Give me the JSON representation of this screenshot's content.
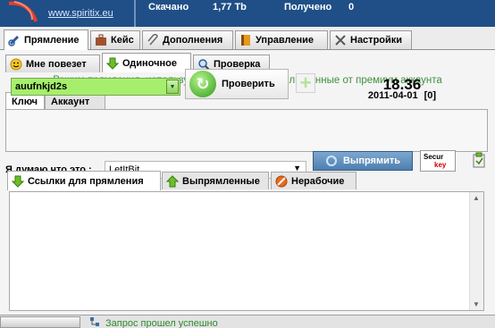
{
  "header": {
    "site": "www.spiritix.eu",
    "downloaded_label": "Скачано",
    "downloaded_value": "1,77 Tb",
    "received_label": "Получено",
    "received_value": "0"
  },
  "main_tabs": [
    {
      "label": "Прямление",
      "icon": "link-icon"
    },
    {
      "label": "Кейс",
      "icon": "briefcase-icon"
    },
    {
      "label": "Дополнения",
      "icon": "paperclip-icon"
    },
    {
      "label": "Управление",
      "icon": "book-icon"
    },
    {
      "label": "Настройки",
      "icon": "tools-icon"
    }
  ],
  "sub_tabs": [
    {
      "label": "Мне повезет",
      "icon": "smiley-icon"
    },
    {
      "label": "Одиночное",
      "icon": "down-arrow-icon"
    },
    {
      "label": "Проверка",
      "icon": "magnifier-icon"
    }
  ],
  "banner": "Режим прямления, используя купленные ключи или данные от премиум аккаунта",
  "key_group": {
    "tabs": [
      "Ключ",
      "Аккаунт"
    ],
    "key_value": "auufnkjd2s",
    "check_label": "Проверить",
    "time": "18.36",
    "date": "2011-04-01",
    "date_count": "[0]"
  },
  "host": {
    "label": "Я думаю что это :",
    "value": "LetItBit",
    "fix_label": "Выпрямить",
    "secur_line1": "Secur",
    "secur_line2": "key"
  },
  "list_tabs": [
    {
      "label": "Ссылки для прямления",
      "icon": "down-arrow-icon"
    },
    {
      "label": "Выпрямленные",
      "icon": "up-arrow-icon"
    },
    {
      "label": "Нерабочие",
      "icon": "forbidden-icon"
    }
  ],
  "status": {
    "text": "Запрос прошел успешно"
  },
  "colors": {
    "header_bg": "#1f4f86",
    "key_field_bg": "#a6ef6c",
    "banner_text": "#3f8f3f",
    "status_text": "#2d8a2d"
  }
}
